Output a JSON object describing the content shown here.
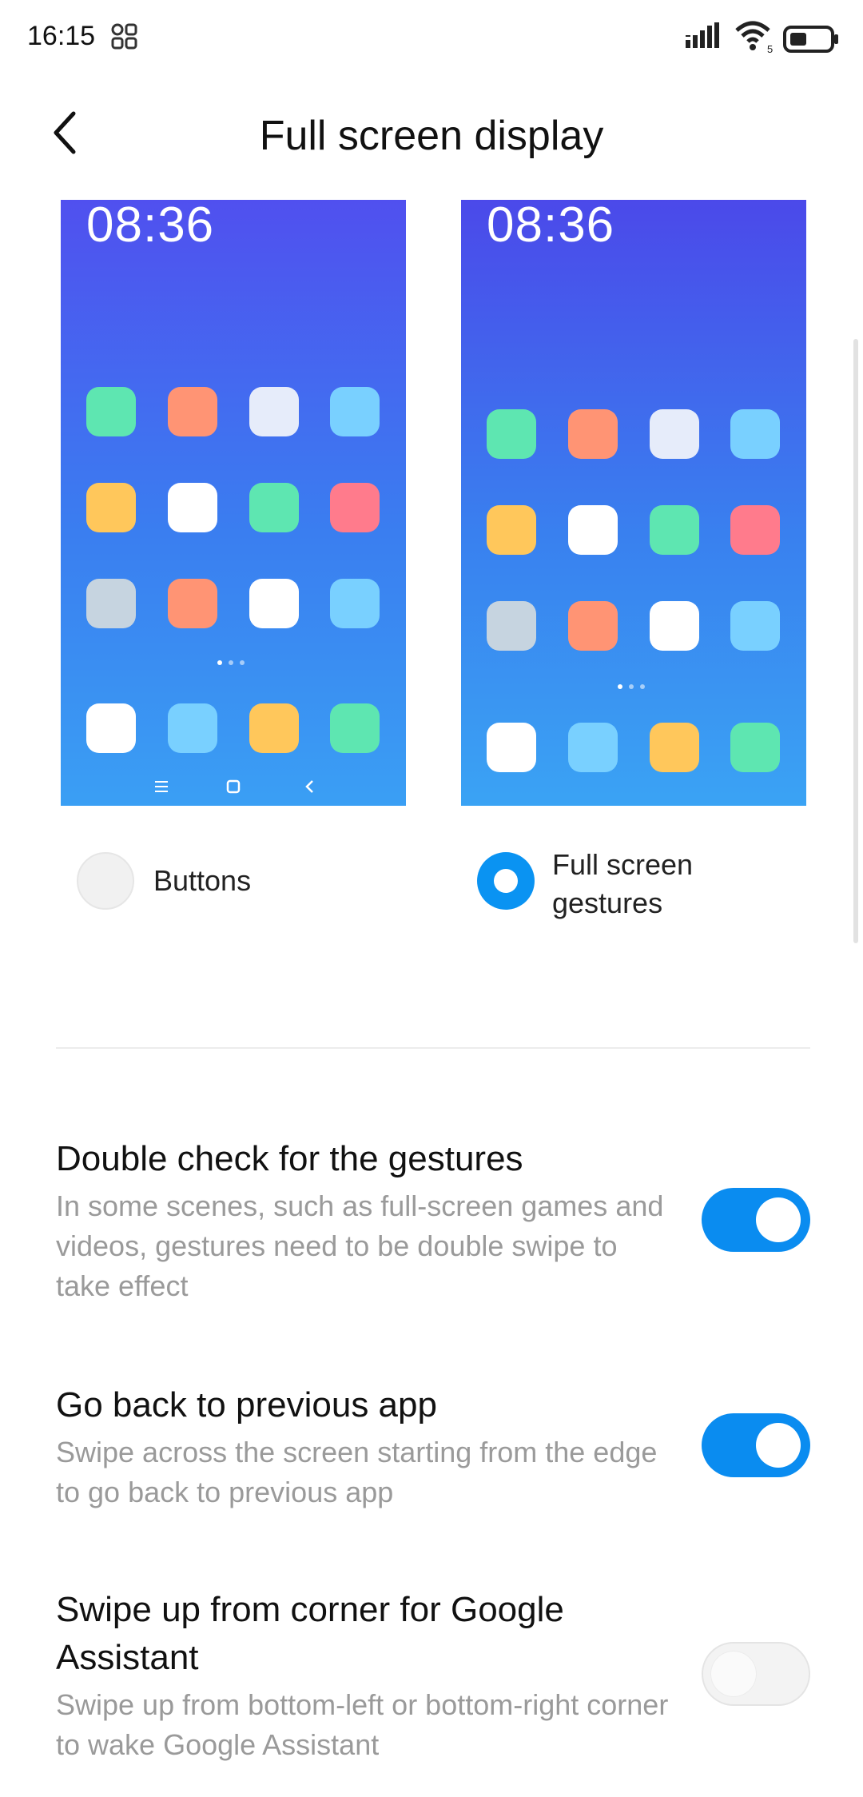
{
  "status_bar": {
    "time": "16:15",
    "wifi_badge": "5",
    "icons": [
      "qr-icon",
      "signal-icon",
      "wifi-icon",
      "battery-icon"
    ]
  },
  "header": {
    "title": "Full screen display",
    "back_icon": "chevron-left-icon"
  },
  "previews": [
    {
      "clock": "08:36",
      "mode": "buttons",
      "navbar_icons": [
        "menu-icon",
        "home-icon",
        "back-icon"
      ]
    },
    {
      "clock": "08:36",
      "mode": "gestures"
    }
  ],
  "options": {
    "buttons": {
      "label": "Buttons",
      "selected": false
    },
    "gestures": {
      "label": "Full screen gestures",
      "selected": true
    }
  },
  "settings": [
    {
      "title": "Double check for the gestures",
      "description": "In some scenes, such as full-screen games and videos, gestures need to be double swipe to take effect",
      "enabled": true
    },
    {
      "title": "Go back to previous app",
      "description": "Swipe across the screen starting from the edge to go back to previous app",
      "enabled": true
    },
    {
      "title": "Swipe up from corner for Google Assistant",
      "description": "Swipe up from bottom-left or bottom-right corner to wake Google Assistant",
      "enabled": false
    }
  ],
  "colors": {
    "accent": "#0a8cf0",
    "text_primary": "#111111",
    "text_secondary": "#9a9a9a",
    "icon_green": "#5ee6b1",
    "icon_orange": "#ff9474",
    "icon_white": "#ffffff",
    "icon_lightblue": "#79d0ff",
    "icon_yellow": "#ffc75b",
    "icon_pink": "#ff7b8c",
    "icon_gray": "#c6d4e0",
    "icon_paleblue": "#e6ecfa"
  }
}
